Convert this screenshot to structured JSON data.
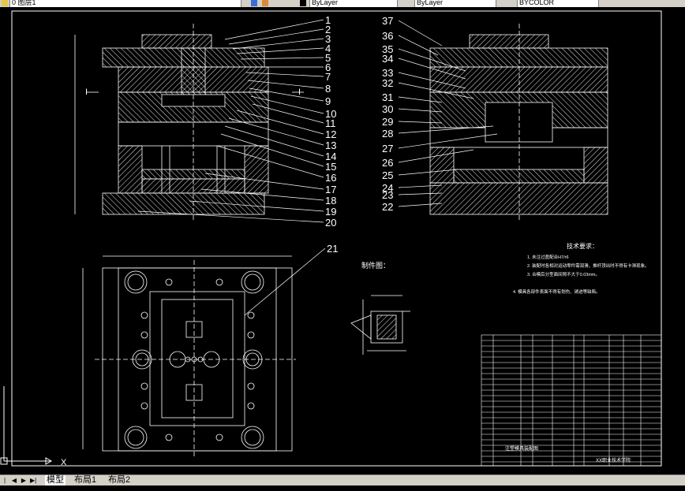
{
  "toolbar": {
    "layer_name": "0 图层1",
    "linetype": "ByLayer",
    "lineweight": "ByLayer",
    "plotstyle": "BYCOLOR"
  },
  "drawing": {
    "callouts": [
      "1",
      "2",
      "3",
      "4",
      "5",
      "6",
      "7",
      "8",
      "9",
      "10",
      "11",
      "12",
      "13",
      "14",
      "15",
      "16",
      "17",
      "18",
      "19",
      "20",
      "21",
      "22",
      "23",
      "24",
      "25",
      "26",
      "27",
      "28",
      "29",
      "30",
      "31",
      "32",
      "33",
      "34",
      "35",
      "36",
      "37"
    ],
    "section_mark": "I",
    "part_view_title": "制件图：",
    "tech_title": "技术要求：",
    "tech_notes": [
      "1. 未注过盈配合H7/r6",
      "2. 装配时各相对运动零件需润滑，推杆顶出时不得有卡滞现象。",
      "3. 合模后分型面间隙不大于0.03mm。",
      "4. 模具各部件表面不得有划伤、锈迹等缺陷。"
    ],
    "title_block": {
      "school": "XX职业技术学院",
      "drawing_name": "注塑模具装配图"
    },
    "axis_label": "X"
  },
  "tabs": {
    "model": "模型",
    "layout1": "布局1",
    "layout2": "布局2"
  }
}
